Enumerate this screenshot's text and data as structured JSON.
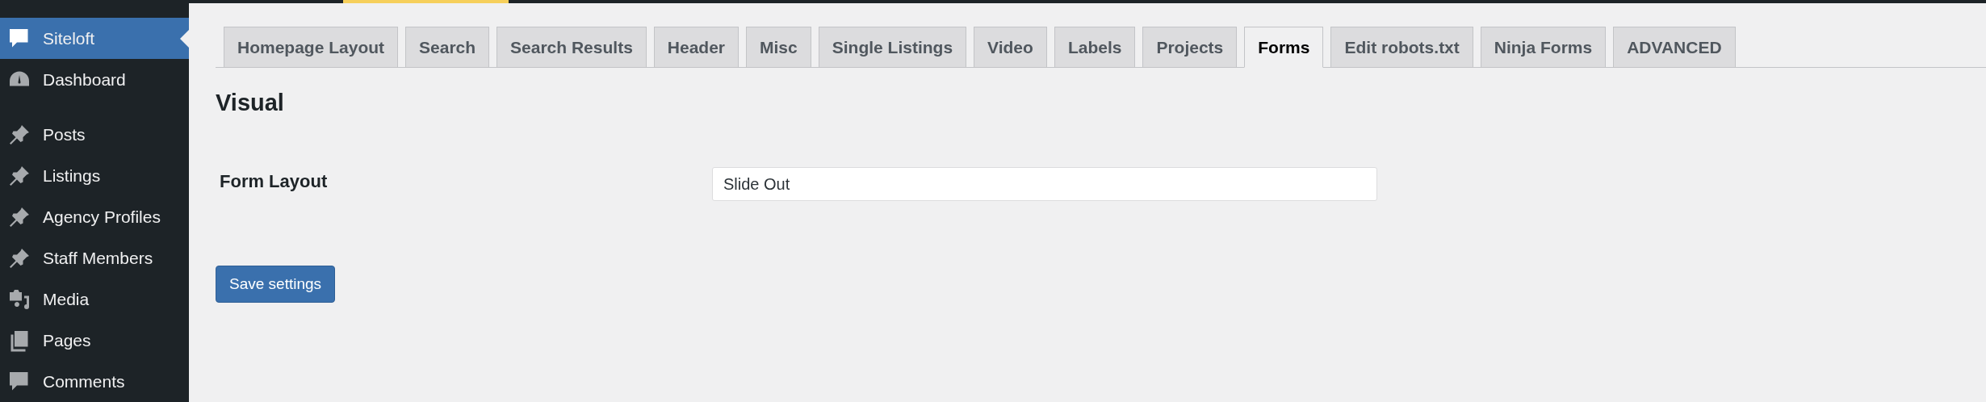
{
  "sidebar": {
    "groups": [
      [
        {
          "label": "Siteloft",
          "selected": true
        },
        {
          "label": "Dashboard",
          "selected": false
        }
      ],
      [
        {
          "label": "Posts",
          "selected": false
        },
        {
          "label": "Listings",
          "selected": false
        },
        {
          "label": "Agency Profiles",
          "selected": false
        },
        {
          "label": "Staff Members",
          "selected": false
        },
        {
          "label": "Media",
          "selected": false
        },
        {
          "label": "Pages",
          "selected": false
        },
        {
          "label": "Comments",
          "selected": false
        }
      ]
    ]
  },
  "tabs": [
    {
      "label": "Homepage Layout",
      "selected": false
    },
    {
      "label": "Search",
      "selected": false
    },
    {
      "label": "Search Results",
      "selected": false
    },
    {
      "label": "Header",
      "selected": false
    },
    {
      "label": "Misc",
      "selected": false
    },
    {
      "label": "Single Listings",
      "selected": false
    },
    {
      "label": "Video",
      "selected": false
    },
    {
      "label": "Labels",
      "selected": false
    },
    {
      "label": "Projects",
      "selected": false
    },
    {
      "label": "Forms",
      "selected": true
    },
    {
      "label": "Edit robots.txt",
      "selected": false
    },
    {
      "label": "Ninja Forms",
      "selected": false
    },
    {
      "label": "ADVANCED",
      "selected": false
    }
  ],
  "section_title": "Visual",
  "fields": [
    {
      "label": "Form Layout",
      "value": "Slide Out"
    }
  ],
  "save_button": "Save settings"
}
